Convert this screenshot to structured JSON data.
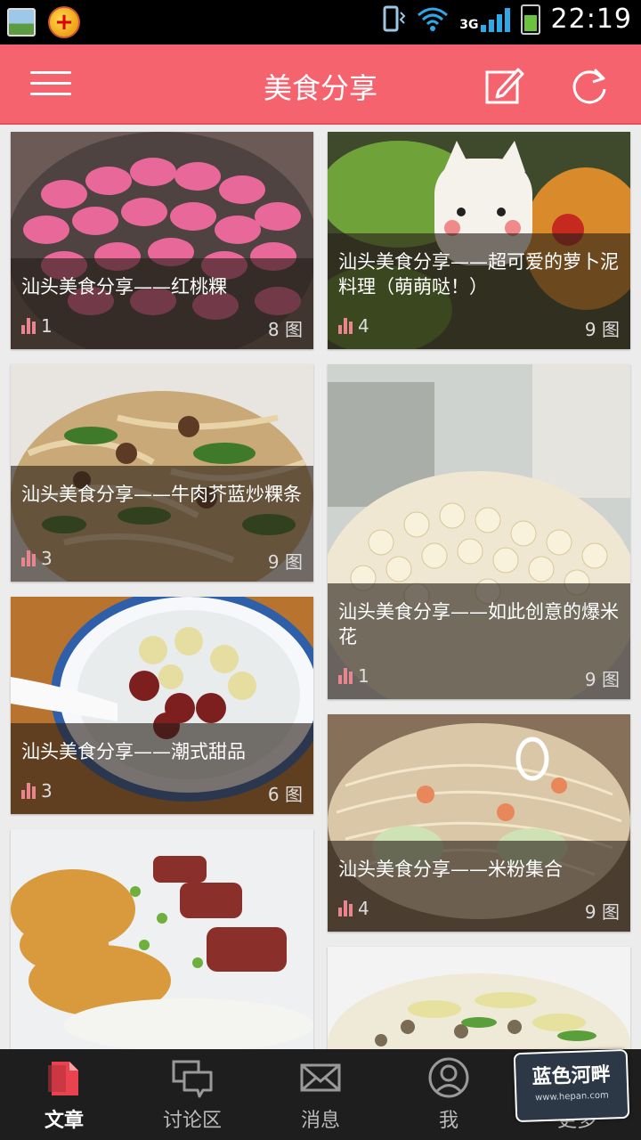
{
  "status_bar": {
    "time": "22:19",
    "network": "3G",
    "icons": [
      "gallery-icon",
      "app-badge-icon",
      "vibrate-icon",
      "wifi-icon",
      "signal-icon",
      "battery-icon"
    ]
  },
  "app_bar": {
    "title": "美食分享",
    "menu_icon": "menu-icon",
    "edit_icon": "edit-icon",
    "refresh_icon": "refresh-icon",
    "color": "#f5636f"
  },
  "articles": [
    {
      "title": "汕头美食分享——红桃粿",
      "views": "1",
      "photos": "8 图"
    },
    {
      "title": "汕头美食分享——超可爱的萝卜泥料理（萌萌哒！）",
      "views": "4",
      "photos": "9 图"
    },
    {
      "title": "汕头美食分享——牛肉芥蓝炒粿条",
      "views": "3",
      "photos": "9 图"
    },
    {
      "title": "汕头美食分享——如此创意的爆米花",
      "views": "1",
      "photos": "9 图"
    },
    {
      "title": "汕头美食分享——潮式甜品",
      "views": "3",
      "photos": "6 图"
    },
    {
      "title": "汕头美食分享——米粉集合",
      "views": "4",
      "photos": "9 图"
    }
  ],
  "bottom_nav": [
    {
      "label": "文章",
      "icon": "article-icon",
      "active": true
    },
    {
      "label": "讨论区",
      "icon": "discussion-icon",
      "active": false
    },
    {
      "label": "消息",
      "icon": "message-icon",
      "active": false
    },
    {
      "label": "我",
      "icon": "profile-icon",
      "active": false
    },
    {
      "label": "更多",
      "icon": "more-icon",
      "active": false
    }
  ],
  "watermark": {
    "text": "蓝色河畔",
    "url": "www.hepan.com"
  }
}
